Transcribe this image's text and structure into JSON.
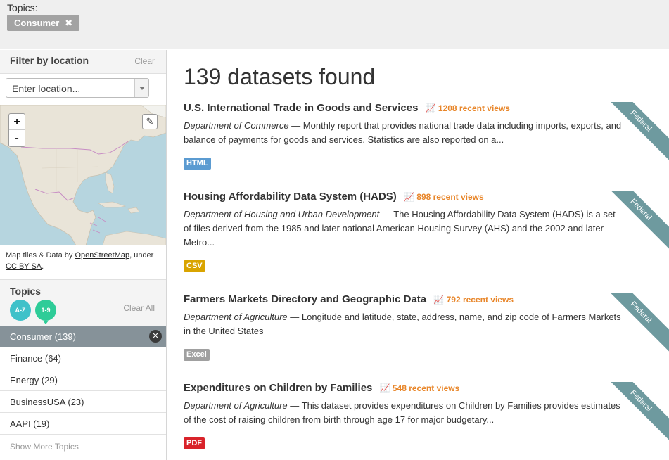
{
  "topics_bar": {
    "label": "Topics:",
    "chip": "Consumer",
    "chip_remove": "✖"
  },
  "sidebar": {
    "filter_title": "Filter by location",
    "filter_clear": "Clear",
    "location_placeholder": "Enter location...",
    "map": {
      "zoom_in": "+",
      "zoom_out": "-",
      "edit_icon": "✎"
    },
    "attribution_prefix": "Map tiles & Data by ",
    "attribution_link1": "OpenStreetMap",
    "attribution_mid": ", under",
    "attribution_link2": "CC BY SA",
    "attribution_end": ".",
    "topics_title": "Topics",
    "sort_az": "A-Z",
    "sort_19": "1-9",
    "topics_clear_all": "Clear All",
    "topics": [
      {
        "label": "Consumer (139)",
        "active": true
      },
      {
        "label": "Finance (64)",
        "active": false
      },
      {
        "label": "Energy (29)",
        "active": false
      },
      {
        "label": "BusinessUSA (23)",
        "active": false
      },
      {
        "label": "AAPI (19)",
        "active": false
      }
    ],
    "remove_icon": "✕",
    "show_more": "Show More Topics"
  },
  "main": {
    "count_heading": "139 datasets found",
    "datasets": [
      {
        "title": "U.S. International Trade in Goods and Services",
        "views": "1208 recent views",
        "org": "Department of Commerce",
        "description": " — Monthly report that provides national trade data including imports, exports, and balance of payments for goods and services. Statistics are also reported on a...",
        "format": "HTML",
        "format_color": "#5b9bd1",
        "ribbon": "Federal"
      },
      {
        "title": "Housing Affordability Data System (HADS)",
        "views": "898 recent views",
        "org": "Department of Housing and Urban Development",
        "description": " — The Housing Affordability Data System (HADS) is a set of files derived from the 1985 and later national American Housing Survey (AHS) and the 2002 and later Metro...",
        "format": "CSV",
        "format_color": "#d9a400",
        "ribbon": "Federal"
      },
      {
        "title": "Farmers Markets Directory and Geographic Data",
        "views": "792 recent views",
        "org": "Department of Agriculture",
        "description": " — Longitude and latitude, state, address, name, and zip code of Farmers Markets in the United States",
        "format": "Excel",
        "format_color": "#a0a0a0",
        "ribbon": "Federal"
      },
      {
        "title": "Expenditures on Children by Families",
        "views": "548 recent views",
        "org": "Department of Agriculture",
        "description": " — This dataset provides expenditures on Children by Families provides estimates of the cost of raising children from birth through age 17 for major budgetary...",
        "format": "PDF",
        "format_color": "#d9232a",
        "ribbon": "Federal"
      }
    ]
  }
}
